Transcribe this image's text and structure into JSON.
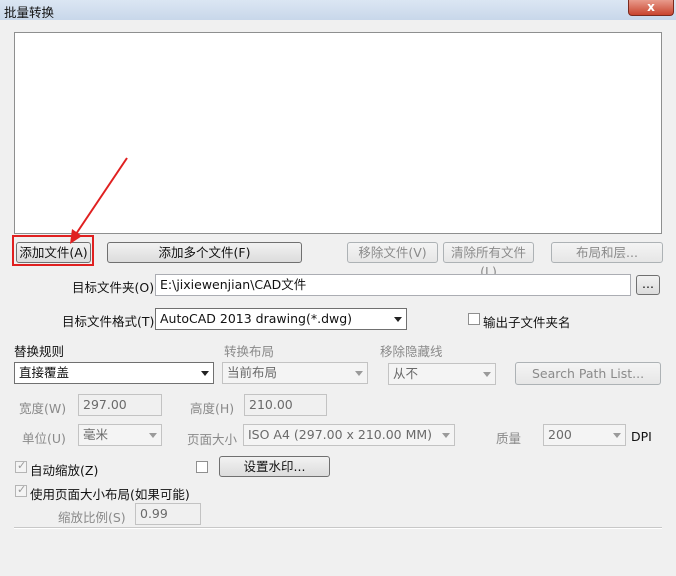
{
  "window": {
    "title": "批量转换",
    "close_label": "x"
  },
  "buttons": {
    "add_file": "添加文件(A)",
    "add_multiple": "添加多个文件(F)",
    "remove_file": "移除文件(V)",
    "clear_all": "清除所有文件(L)",
    "layout_layers": "布局和层...",
    "browse": "...",
    "watermark": "设置水印...",
    "search_path": "Search Path List..."
  },
  "target_folder": {
    "label": "目标文件夹(O)",
    "value": "E:\\jixiewenjian\\CAD文件"
  },
  "target_format": {
    "label": "目标文件格式(T)",
    "value": "AutoCAD 2013 drawing(*.dwg)"
  },
  "output_subfolder": {
    "label": "输出子文件夹名",
    "checked": false
  },
  "replace_rule": {
    "label": "替换规则",
    "value": "直接覆盖"
  },
  "convert_layout": {
    "label": "转换布局",
    "value": "当前布局"
  },
  "remove_hidden": {
    "label": "移除隐藏线",
    "value": "从不"
  },
  "width": {
    "label": "宽度(W)",
    "value": "297.00"
  },
  "height": {
    "label": "高度(H)",
    "value": "210.00"
  },
  "unit": {
    "label": "单位(U)",
    "value": "毫米"
  },
  "page_size": {
    "label": "页面大小",
    "value": "ISO A4 (297.00 x 210.00 MM)"
  },
  "quality": {
    "label": "质量",
    "value": "200",
    "unit": "DPI"
  },
  "auto_scale": {
    "label": "自动缩放(Z)",
    "checked": true
  },
  "watermark_checkbox": {
    "checked": false
  },
  "use_page_layout": {
    "label": "使用页面大小布局(如果可能)",
    "checked": true
  },
  "scale_ratio": {
    "label": "缩放比例(S)",
    "value": "0.99"
  },
  "colors": {
    "highlight": "#e02020",
    "arrow": "#e02020"
  }
}
